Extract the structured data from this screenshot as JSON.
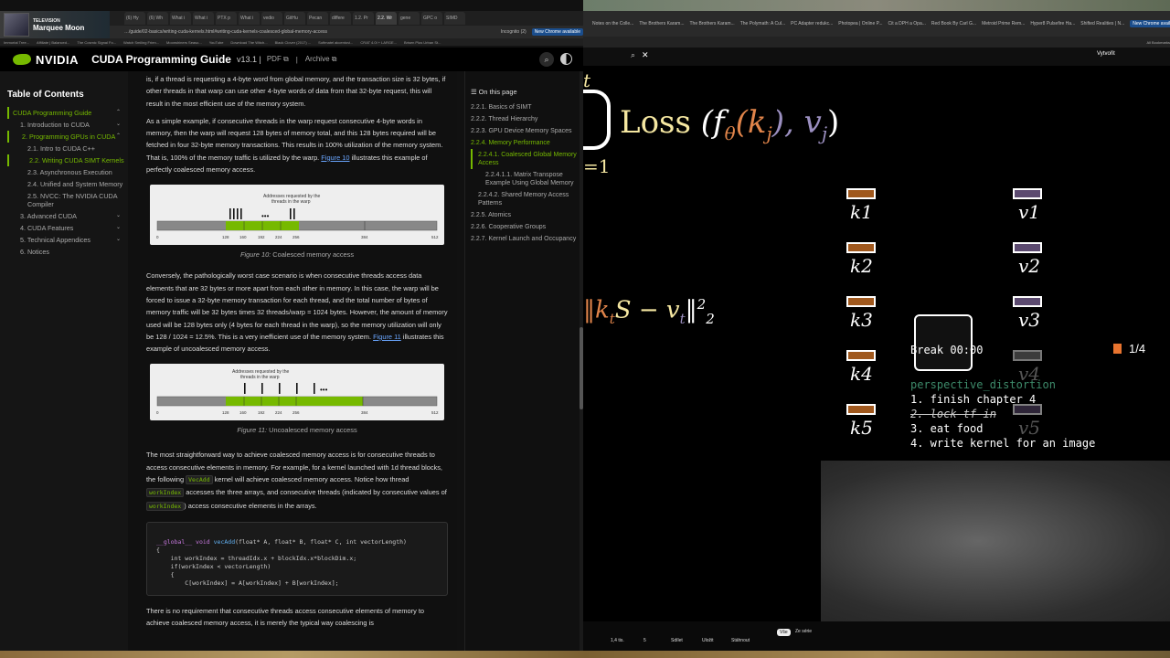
{
  "left_browser": {
    "media_widget": {
      "label": "TELEVISION",
      "title": "Marquee Moon"
    },
    "tabs": [
      "(6) Hy",
      "(6) Wh",
      "What i",
      "What i",
      "PTX p",
      "What i",
      "vedio",
      "GitHu",
      "Pecan",
      "differe",
      "1.2. Pr",
      "2.2. Wr",
      "gene",
      "GPC o",
      "SIMD"
    ],
    "active_tab_index": 11,
    "url": "…/guide/02-basics/writing-cuda-kernels.html#writing-cuda-kernels-coalesced-global-memory-access",
    "incognito": "Incognito (2)",
    "chrome_update": "New Chrome available",
    "bookmarks": [
      "Immortal Tree...",
      "Affiliate | Balanced...",
      "The Cosmic Signal Fo...",
      "Watch Smiling Frien...",
      "Moonshiners Seaso...",
      "YouTube",
      "Download The Witch...",
      "Black Clover (2017) ...",
      "Softmatel akcentovi...",
      "CRAT 4.0l + LARGE...",
      "Brisen Plus Urban St..."
    ],
    "header": {
      "brand": "NVIDIA",
      "title": "CUDA Programming Guide",
      "version": "v13.1 |",
      "pdf": "PDF ⧉",
      "sep": "|",
      "archive": "Archive ⧉"
    }
  },
  "toc": {
    "heading": "Table of Contents",
    "items": [
      {
        "label": "CUDA Programming Guide",
        "level": 0,
        "active": true,
        "chevron": "⌃"
      },
      {
        "label": "1. Introduction to CUDA",
        "level": 1,
        "active": false,
        "chevron": "⌄"
      },
      {
        "label": "2. Programming GPUs in CUDA",
        "level": 1,
        "active": true,
        "chevron": "⌃"
      },
      {
        "label": "2.1. Intro to CUDA C++",
        "level": 2,
        "active": false,
        "chevron": ""
      },
      {
        "label": "2.2. Writing CUDA SIMT Kernels",
        "level": 2,
        "active": true,
        "chevron": ""
      },
      {
        "label": "2.3. Asynchronous Execution",
        "level": 2,
        "active": false,
        "chevron": ""
      },
      {
        "label": "2.4. Unified and System Memory",
        "level": 2,
        "active": false,
        "chevron": ""
      },
      {
        "label": "2.5. NVCC: The NVIDIA CUDA Compiler",
        "level": 2,
        "active": false,
        "chevron": ""
      },
      {
        "label": "3. Advanced CUDA",
        "level": 1,
        "active": false,
        "chevron": "⌄"
      },
      {
        "label": "4. CUDA Features",
        "level": 1,
        "active": false,
        "chevron": "⌄"
      },
      {
        "label": "5. Technical Appendices",
        "level": 1,
        "active": false,
        "chevron": "⌄"
      },
      {
        "label": "6. Notices",
        "level": 1,
        "active": false,
        "chevron": ""
      }
    ]
  },
  "article": {
    "p0": "is, if a thread is requesting a 4-byte word from global memory, and the transaction size is 32 bytes, if other threads in that warp can use other 4-byte words of data from that 32-byte request, this will result in the most efficient use of the memory system.",
    "p1_pre": "As a simple example, if consecutive threads in the warp request consecutive 4-byte words in memory, then the warp will request 128 bytes of memory total, and this 128 bytes required will be fetched in four 32-byte memory transactions. This results in 100% utilization of the memory system. That is, 100% of the memory traffic is utilized by the warp. ",
    "p1_link": "Figure 10",
    "p1_post": " illustrates this example of perfectly coalesced memory access.",
    "fig10": {
      "addr_label_1": "Addresses requested by the",
      "addr_label_2": "threads in the warp",
      "dots": "•••",
      "ticks": [
        "0",
        "128",
        "160",
        "192",
        "224",
        "256",
        "384",
        "512"
      ],
      "caption_prefix": "Figure 10:",
      "caption": " Coalesced memory access"
    },
    "p2_pre": "Conversely, the pathologically worst case scenario is when consecutive threads access data elements that are 32 bytes or more apart from each other in memory. In this case, the warp will be forced to issue a 32-byte memory transaction for each thread, and the total number of bytes of memory traffic will be 32 bytes times 32 threads/warp = 1024 bytes. However, the amount of memory used will be 128 bytes only (4 bytes for each thread in the warp), so the memory utilization will only be 128 / 1024 = 12.5%. This is a very inefficient use of the memory system. ",
    "p2_link": "Figure 11",
    "p2_post": " illustrates this example of uncoalesced memory access.",
    "fig11": {
      "addr_label_1": "Addresses requested by the",
      "addr_label_2": "threads in the warp",
      "dots": "•••",
      "ticks": [
        "0",
        "128",
        "160",
        "192",
        "224",
        "256",
        "384",
        "512"
      ],
      "caption_prefix": "Figure 11:",
      "caption": " Uncoalesced memory access"
    },
    "p3_a": "The most straightforward way to achieve coalesced memory access is for consecutive threads to access consecutive elements in memory. For example, for a kernel launched with 1d thread blocks, the following ",
    "p3_code1": "VecAdd",
    "p3_b": " kernel will achieve coalesced memory access. Notice how thread ",
    "p3_code2": "workIndex",
    "p3_c": " accesses the three arrays, and consecutive threads (indicated by consecutive values of ",
    "p3_code3": "workIndex",
    "p3_d": ") access consecutive elements in the arrays.",
    "code": {
      "l1_kw": "__global__ void ",
      "l1_fn": "vecAdd",
      "l1_args": "(float* A, float* B, float* C, int vectorLength)",
      "l2": "{",
      "l3": "    int workIndex = threadIdx.x + blockIdx.x*blockDim.x;",
      "l4": "    if(workIndex < vectorLength)",
      "l5": "    {",
      "l6": "        C[workIndex] = A[workIndex] + B[workIndex];"
    },
    "p4": "There is no requirement that consecutive threads access consecutive elements of memory to achieve coalesced memory access, it is merely the typical way coalescing is"
  },
  "on_this_page": {
    "title": "☰ On this page",
    "items": [
      {
        "label": "2.2.1. Basics of SIMT",
        "indent": 0,
        "active": false
      },
      {
        "label": "2.2.2. Thread Hierarchy",
        "indent": 0,
        "active": false
      },
      {
        "label": "2.2.3. GPU Device Memory Spaces",
        "indent": 0,
        "active": false
      },
      {
        "label": "2.2.4. Memory Performance",
        "indent": 0,
        "active": true
      },
      {
        "label": "2.2.4.1. Coalesced Global Memory Access",
        "indent": 1,
        "active": true
      },
      {
        "label": "2.2.4.1.1. Matrix Transpose Example Using Global Memory",
        "indent": 2,
        "active": false
      },
      {
        "label": "2.2.4.2. Shared Memory Access Patterns",
        "indent": 1,
        "active": false
      },
      {
        "label": "2.2.5. Atomics",
        "indent": 0,
        "active": false
      },
      {
        "label": "2.2.6. Cooperative Groups",
        "indent": 0,
        "active": false
      },
      {
        "label": "2.2.7. Kernel Launch and Occupancy",
        "indent": 0,
        "active": false
      }
    ]
  },
  "right_browser": {
    "tabs": [
      "Notes on the Colle...",
      "The Brothers Karam...",
      "The Brothers Karam...",
      "The Polymath: A Cul...",
      "PC Adapter redukc...",
      "Photopea | Online P...",
      "Cit a DPH a Opa...",
      "Red Book By Carl G...",
      "Metroid Prime Rem...",
      "Hyper8 Pulsefire Ha...",
      "Shifted Realities | N..."
    ],
    "chrome_update": "New Chrome available",
    "all_bookmarks": "All Bookmarks",
    "account_label": "Vytvořit",
    "video": {
      "sum_lower": "=1",
      "sum_upper": "t",
      "loss_text": "Loss",
      "loss_args": "(f",
      "theta": "θ",
      "k": "(k",
      "j": "j",
      "comma": "), v",
      "j2": "j",
      "close": ")",
      "norm_expr": "‖k",
      "norm_t": "t",
      "norm_s": "S − v",
      "norm_t2": "t",
      "norm_end": "‖",
      "norm_exp": "2",
      "norm_sub": "2",
      "keys": [
        "k1",
        "k2",
        "k3",
        "k4",
        "k5"
      ],
      "values": [
        "v1",
        "v2",
        "v3",
        "v4",
        "v5"
      ],
      "page_counter": "1/4",
      "break_label": "Break 00:00",
      "distortion": "perspective_distortion",
      "todo": [
        "1. finish chapter 4",
        "2. lock tf in",
        "3. eat food",
        "4. write kernel for an image"
      ],
      "todo_struck_index": 1
    },
    "yt_buttons": [
      "1,4 tis.",
      "5",
      "Sdílet",
      "Uložit",
      "Stáhnout",
      "Vše",
      "Ze série"
    ]
  }
}
